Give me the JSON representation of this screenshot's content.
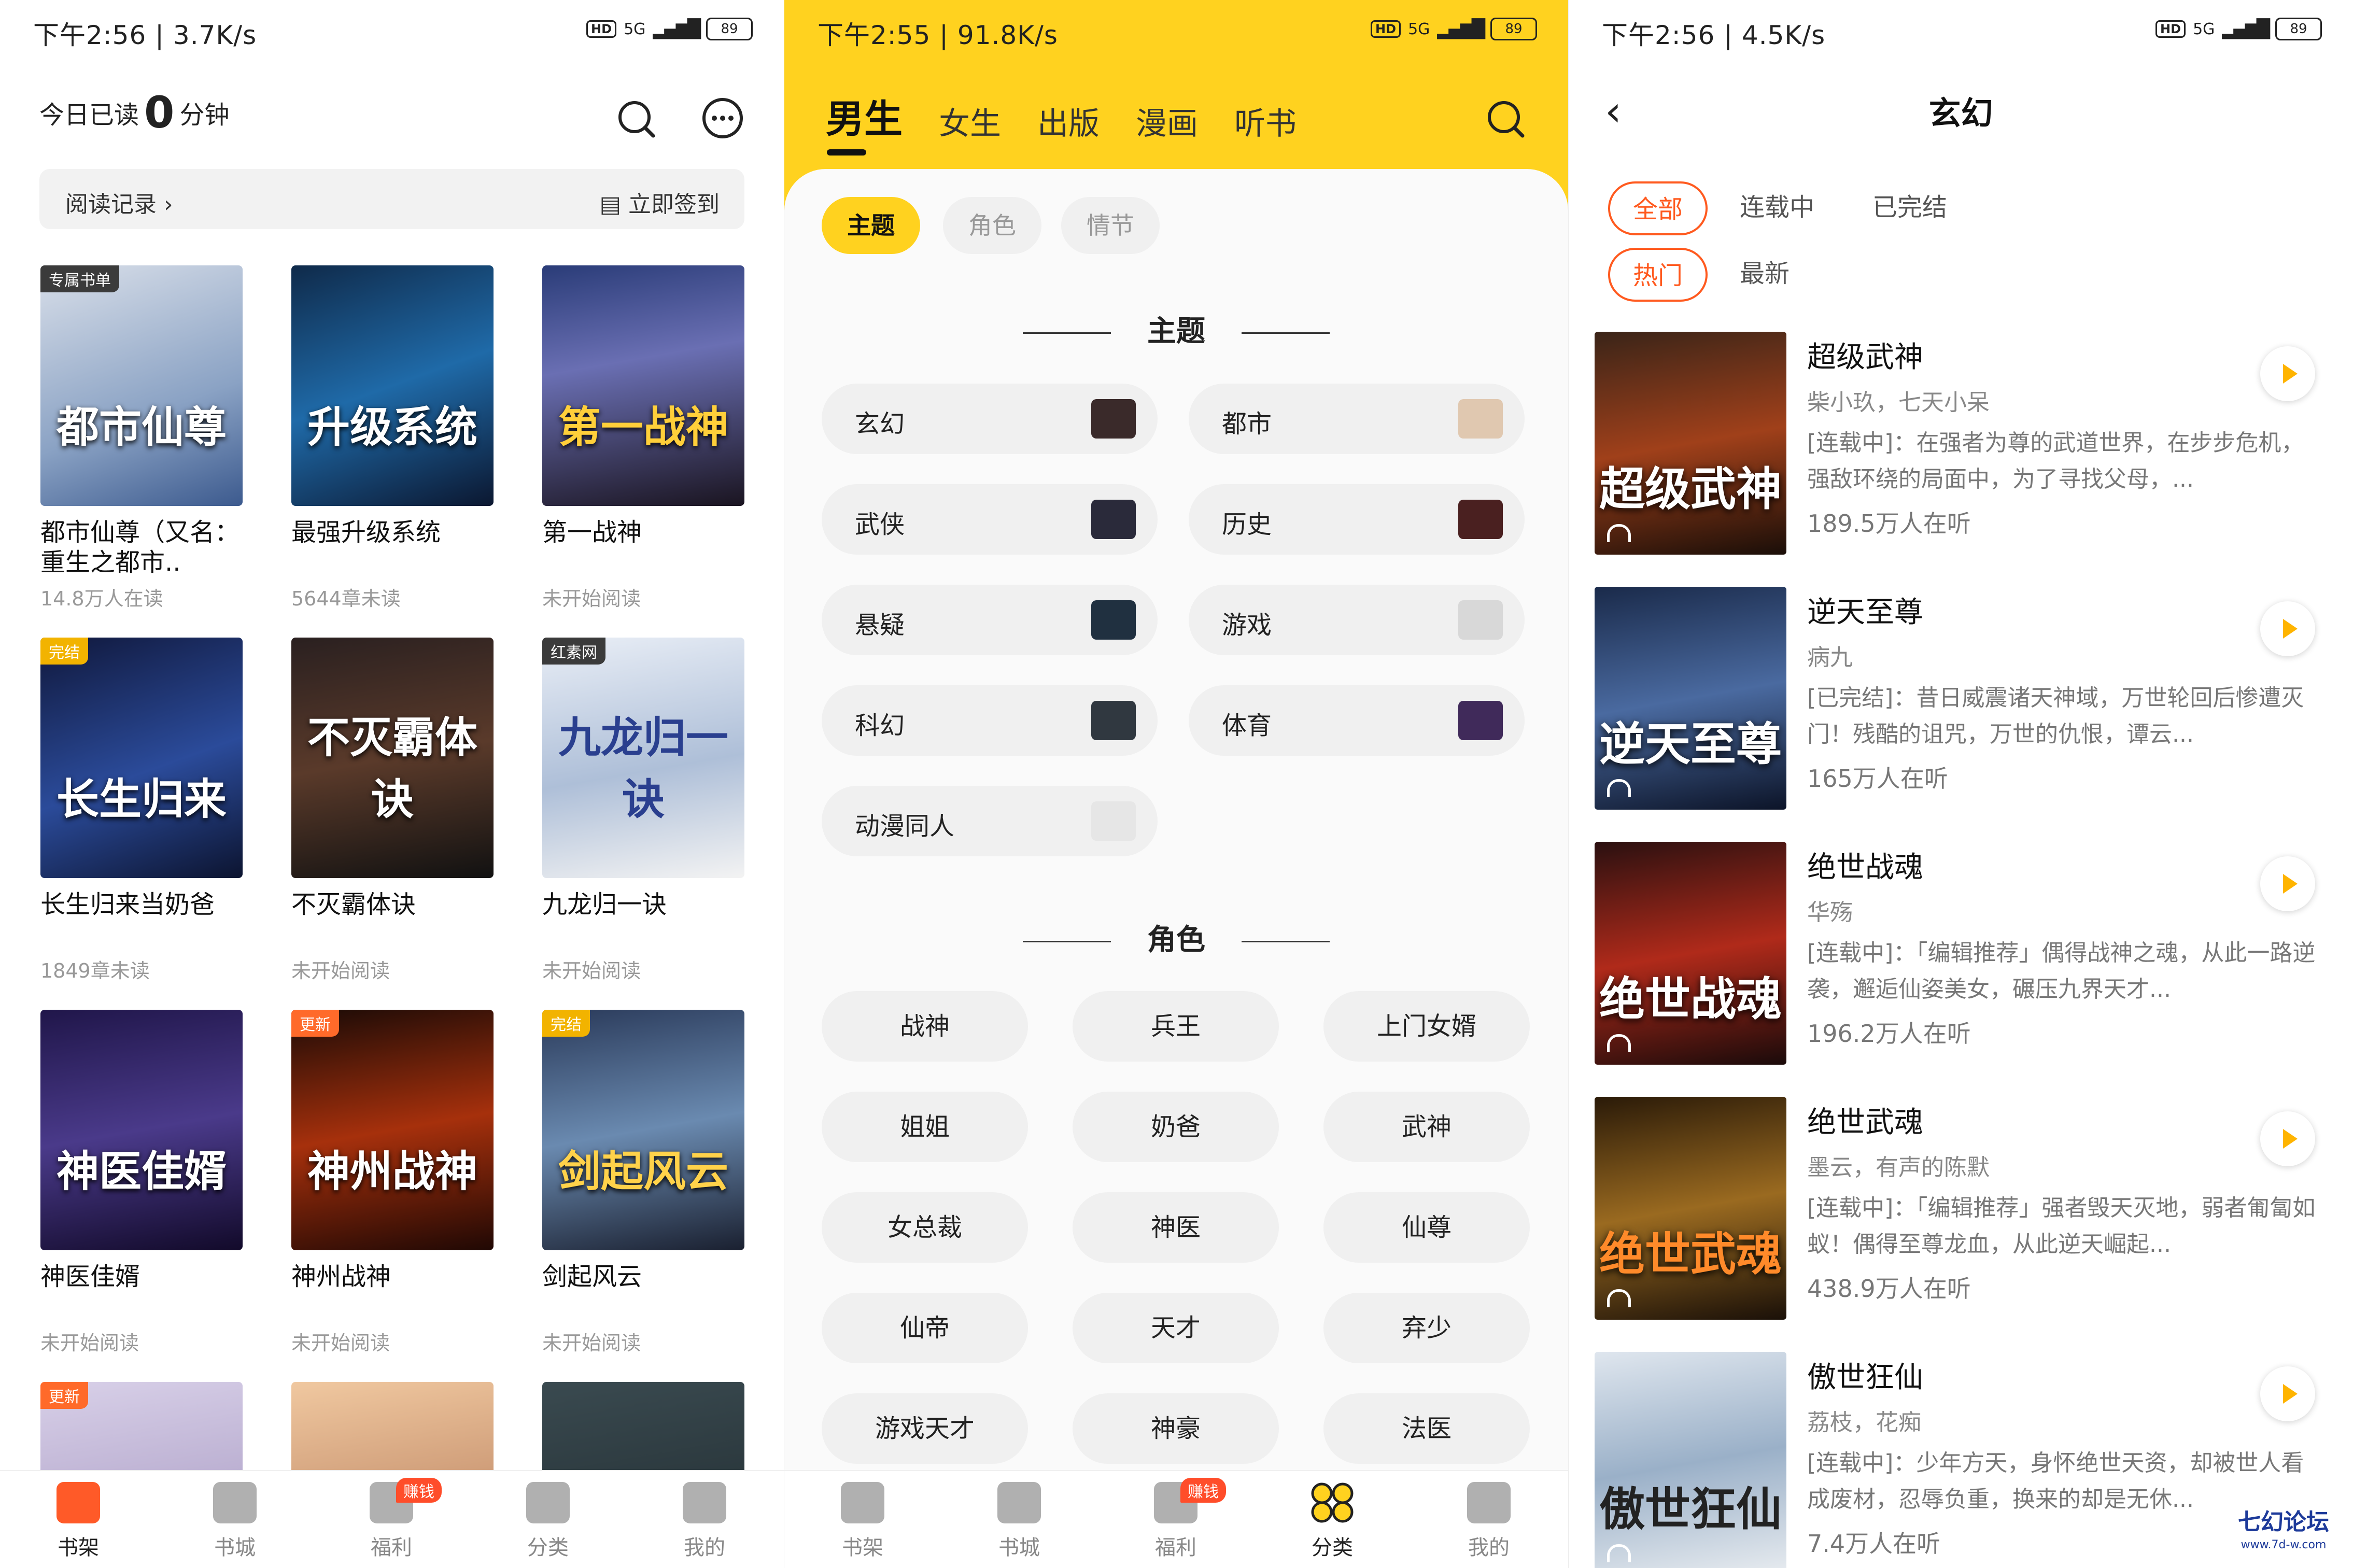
{
  "p1": {
    "status": {
      "time": "下午2:56 | 3.7K/s",
      "signal": "5G",
      "battery": "89"
    },
    "read_prefix": "今日已读",
    "read_count": "0",
    "read_suffix": "分钟",
    "history": "阅读记录 ›",
    "checkin": "立即签到",
    "books": [
      {
        "title": "都市仙尊（又名：重生之都市..",
        "sub": "14.8万人在读",
        "badge": "专属书单",
        "cover": "都市仙尊"
      },
      {
        "title": "最强升级系统",
        "sub": "5644章未读",
        "badge": "",
        "cover": "升级系统"
      },
      {
        "title": "第一战神",
        "sub": "未开始阅读",
        "badge": "",
        "cover": "第一战神"
      },
      {
        "title": "长生归来当奶爸",
        "sub": "1849章未读",
        "badge": "完结",
        "cover": "长生归来"
      },
      {
        "title": "不灭霸体诀",
        "sub": "未开始阅读",
        "badge": "",
        "cover": "不灭霸体诀"
      },
      {
        "title": "九龙归一诀",
        "sub": "未开始阅读",
        "badge": "红素网",
        "cover": "九龙归一诀"
      },
      {
        "title": "神医佳婿",
        "sub": "未开始阅读",
        "badge": "",
        "cover": "神医佳婿"
      },
      {
        "title": "神州战神",
        "sub": "未开始阅读",
        "badge": "更新",
        "cover": "神州战神"
      },
      {
        "title": "剑起风云",
        "sub": "未开始阅读",
        "badge": "完结",
        "cover": "剑起风云"
      },
      {
        "badge": "更新"
      }
    ]
  },
  "tabs": [
    "书架",
    "书城",
    "福利",
    "分类",
    "我的"
  ],
  "earn_badge": "赚钱",
  "p2": {
    "status": {
      "time": "下午2:55 | 91.8K/s",
      "signal": "5G",
      "battery": "89"
    },
    "nav": [
      "男生",
      "女生",
      "出版",
      "漫画",
      "听书"
    ],
    "chips": [
      "主题",
      "角色",
      "情节"
    ],
    "section_theme": "主题",
    "themes": [
      "玄幻",
      "都市",
      "武侠",
      "历史",
      "悬疑",
      "游戏",
      "科幻",
      "体育",
      "动漫同人"
    ],
    "section_role": "角色",
    "roles": [
      "战神",
      "兵王",
      "上门女婿",
      "姐姐",
      "奶爸",
      "武神",
      "女总裁",
      "神医",
      "仙尊",
      "仙帝",
      "天才",
      "弃少",
      "游戏天才",
      "神豪",
      "法医"
    ]
  },
  "p3": {
    "status": {
      "time": "下午2:56 | 4.5K/s",
      "signal": "5G",
      "battery": "89"
    },
    "title": "玄幻",
    "filters1": [
      "全部",
      "连载中",
      "已完结"
    ],
    "filters2": [
      "热门",
      "最新"
    ],
    "items": [
      {
        "title": "超级武神",
        "author": "柴小玖，七天小呆",
        "desc": "[连载中]：在强者为尊的武道世界，在步步危机，强敌环绕的局面中，为了寻找父母，...",
        "listen": "189.5万人在听",
        "cover": "超级武神"
      },
      {
        "title": "逆天至尊",
        "author": "病九",
        "desc": "[已完结]：昔日威震诸天神域，万世轮回后惨遭灭门！残酷的诅咒，万世的仇恨，谭云...",
        "listen": "165万人在听",
        "cover": "逆天至尊"
      },
      {
        "title": "绝世战魂",
        "author": "华殇",
        "desc": "[连载中]：「编辑推荐」偶得战神之魂，从此一路逆袭，邂逅仙姿美女，碾压九界天才...",
        "listen": "196.2万人在听",
        "cover": "绝世战魂"
      },
      {
        "title": "绝世武魂",
        "author": "墨云，有声的陈默",
        "desc": "[连载中]：「编辑推荐」强者毁天灭地，弱者匍匐如蚁！偶得至尊龙血，从此逆天崛起...",
        "listen": "438.9万人在听",
        "cover": "绝世武魂"
      },
      {
        "title": "傲世狂仙",
        "author": "荔枝，花痴",
        "desc": "[连载中]：少年方天，身怀绝世天资，却被世人看成废材，忍辱负重，换来的却是无休...",
        "listen": "7.4万人在听",
        "cover": "傲世狂仙"
      }
    ],
    "watermark": "七幻论坛",
    "watermark_url": "www.7d-w.com"
  },
  "colors": {
    "accent_yellow": "#ffd21f",
    "accent_orange": "#ff5a1f",
    "badge_red": "#ff4d2a"
  }
}
